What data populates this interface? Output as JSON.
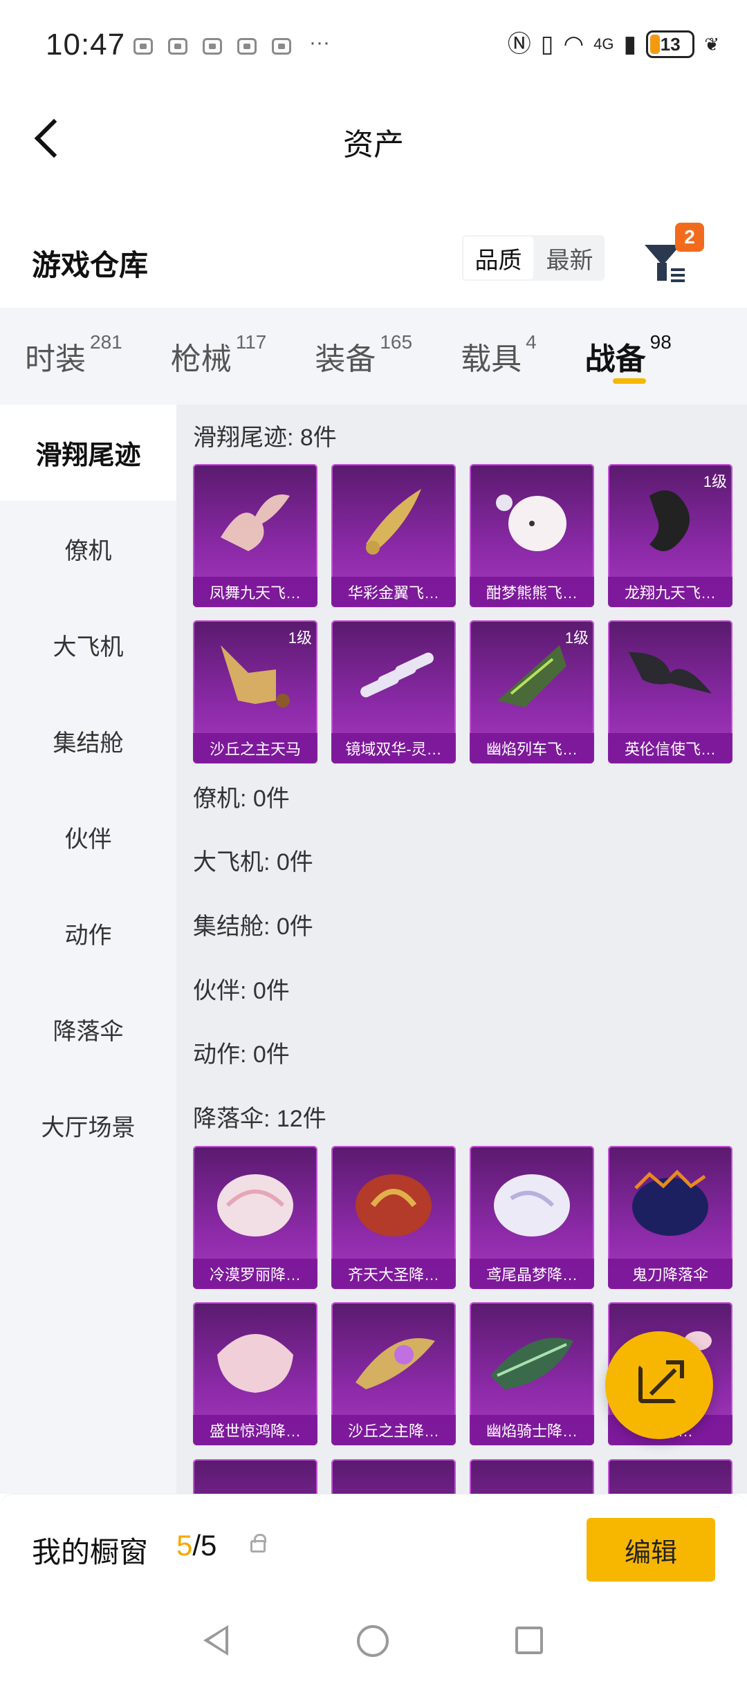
{
  "status_bar": {
    "time": "10:47",
    "more": "···",
    "network": "4G",
    "battery": "13"
  },
  "header": {
    "title": "资产"
  },
  "warehouse": {
    "title": "游戏仓库",
    "sort_options": [
      "品质",
      "最新"
    ],
    "filter_badge": "2"
  },
  "tabs": [
    {
      "label": "时装",
      "count": "281"
    },
    {
      "label": "枪械",
      "count": "117"
    },
    {
      "label": "装备",
      "count": "165"
    },
    {
      "label": "载具",
      "count": "4"
    },
    {
      "label": "战备",
      "count": "98"
    }
  ],
  "sidebar": [
    "滑翔尾迹",
    "僚机",
    "大飞机",
    "集结舱",
    "伙伴",
    "动作",
    "降落伞",
    "大厅场景"
  ],
  "sections": [
    "滑翔尾迹: 8件",
    "僚机: 0件",
    "大飞机: 0件",
    "集结舱: 0件",
    "伙伴: 0件",
    "动作: 0件",
    "降落伞: 12件"
  ],
  "items": [
    {
      "name": "凤舞九天飞…",
      "level": ""
    },
    {
      "name": "华彩金翼飞…",
      "level": ""
    },
    {
      "name": "酣梦熊熊飞…",
      "level": ""
    },
    {
      "name": "龙翔九天飞…",
      "level": "1级"
    },
    {
      "name": "沙丘之主天马",
      "level": "1级"
    },
    {
      "name": "镜域双华-灵…",
      "level": ""
    },
    {
      "name": "幽焰列车飞…",
      "level": "1级"
    },
    {
      "name": "英伦信使飞…",
      "level": ""
    },
    {
      "name": "冷漠罗丽降…",
      "level": ""
    },
    {
      "name": "齐天大圣降…",
      "level": ""
    },
    {
      "name": "鸢尾晶梦降…",
      "level": ""
    },
    {
      "name": "鬼刀降落伞",
      "level": ""
    },
    {
      "name": "盛世惊鸿降…",
      "level": ""
    },
    {
      "name": "沙丘之主降…",
      "level": ""
    },
    {
      "name": "幽焰骑士降…",
      "level": ""
    },
    {
      "name": "…降…",
      "level": ""
    }
  ],
  "bottom": {
    "label": "我的橱窗",
    "current": "5",
    "total": "/5",
    "edit": "编辑"
  },
  "colors": {
    "accent": "#f7b600",
    "badge": "#f26b1d",
    "item_bg": "#8c2aa8"
  }
}
